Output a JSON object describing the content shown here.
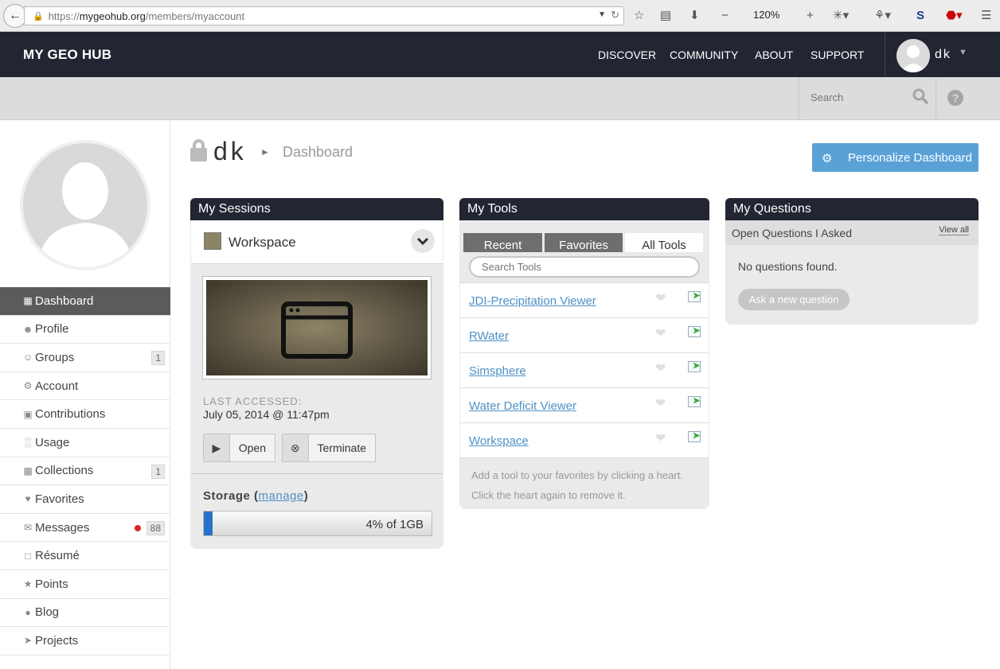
{
  "browser": {
    "url_scheme": "https://",
    "url_domain": "mygeohub.org",
    "url_path": "/members/myaccount",
    "zoom": "120%"
  },
  "header": {
    "logo": "MY GEO HUB",
    "nav": [
      "DISCOVER",
      "COMMUNITY",
      "ABOUT",
      "SUPPORT"
    ],
    "username": "dk"
  },
  "subheader": {
    "search_placeholder": "Search"
  },
  "sidebar": {
    "items": [
      {
        "label": "Dashboard",
        "icon": "dashboard-icon",
        "active": true
      },
      {
        "label": "Profile",
        "icon": "user-icon"
      },
      {
        "label": "Groups",
        "icon": "groups-icon",
        "badge": "1"
      },
      {
        "label": "Account",
        "icon": "gears-icon"
      },
      {
        "label": "Contributions",
        "icon": "book-icon"
      },
      {
        "label": "Usage",
        "icon": "bar-chart-icon"
      },
      {
        "label": "Collections",
        "icon": "collection-icon",
        "badge": "1"
      },
      {
        "label": "Favorites",
        "icon": "heart-icon"
      },
      {
        "label": "Messages",
        "icon": "envelope-icon",
        "badge": "88"
      },
      {
        "label": "Résumé",
        "icon": "document-icon"
      },
      {
        "label": "Points",
        "icon": "points-icon"
      },
      {
        "label": "Blog",
        "icon": "speech-bubble-icon"
      },
      {
        "label": "Projects",
        "icon": "send-icon"
      }
    ]
  },
  "main": {
    "page_user": "dk",
    "breadcrumb_page": "Dashboard",
    "personalize_label": "Personalize Dashboard"
  },
  "sessions": {
    "title": "My Sessions",
    "session_name": "Workspace",
    "last_accessed_label": "LAST ACCESSED:",
    "last_accessed_value": "July 05, 2014 @ 11:47pm",
    "open_label": "Open",
    "terminate_label": "Terminate",
    "storage_label": "Storage",
    "storage_manage": "manage",
    "storage_text": "4% of 1GB",
    "storage_percent": 4
  },
  "tools": {
    "title": "My Tools",
    "tabs": [
      "Recent",
      "Favorites",
      "All Tools"
    ],
    "search_placeholder": "Search Tools",
    "items": [
      "JDI-Precipitation Viewer",
      "RWater",
      "Simsphere",
      "Water Deficit Viewer",
      "Workspace"
    ],
    "tip": "Add a tool to your favorites by clicking a heart. Click the heart again to remove it."
  },
  "questions": {
    "title": "My Questions",
    "subheader": "Open Questions I Asked",
    "view_all": "View all",
    "empty": "No questions found.",
    "ask_label": "Ask a new question"
  },
  "colors": {
    "header_bg": "#222532",
    "accent": "#5aa1d8",
    "link": "#4f91c6"
  }
}
